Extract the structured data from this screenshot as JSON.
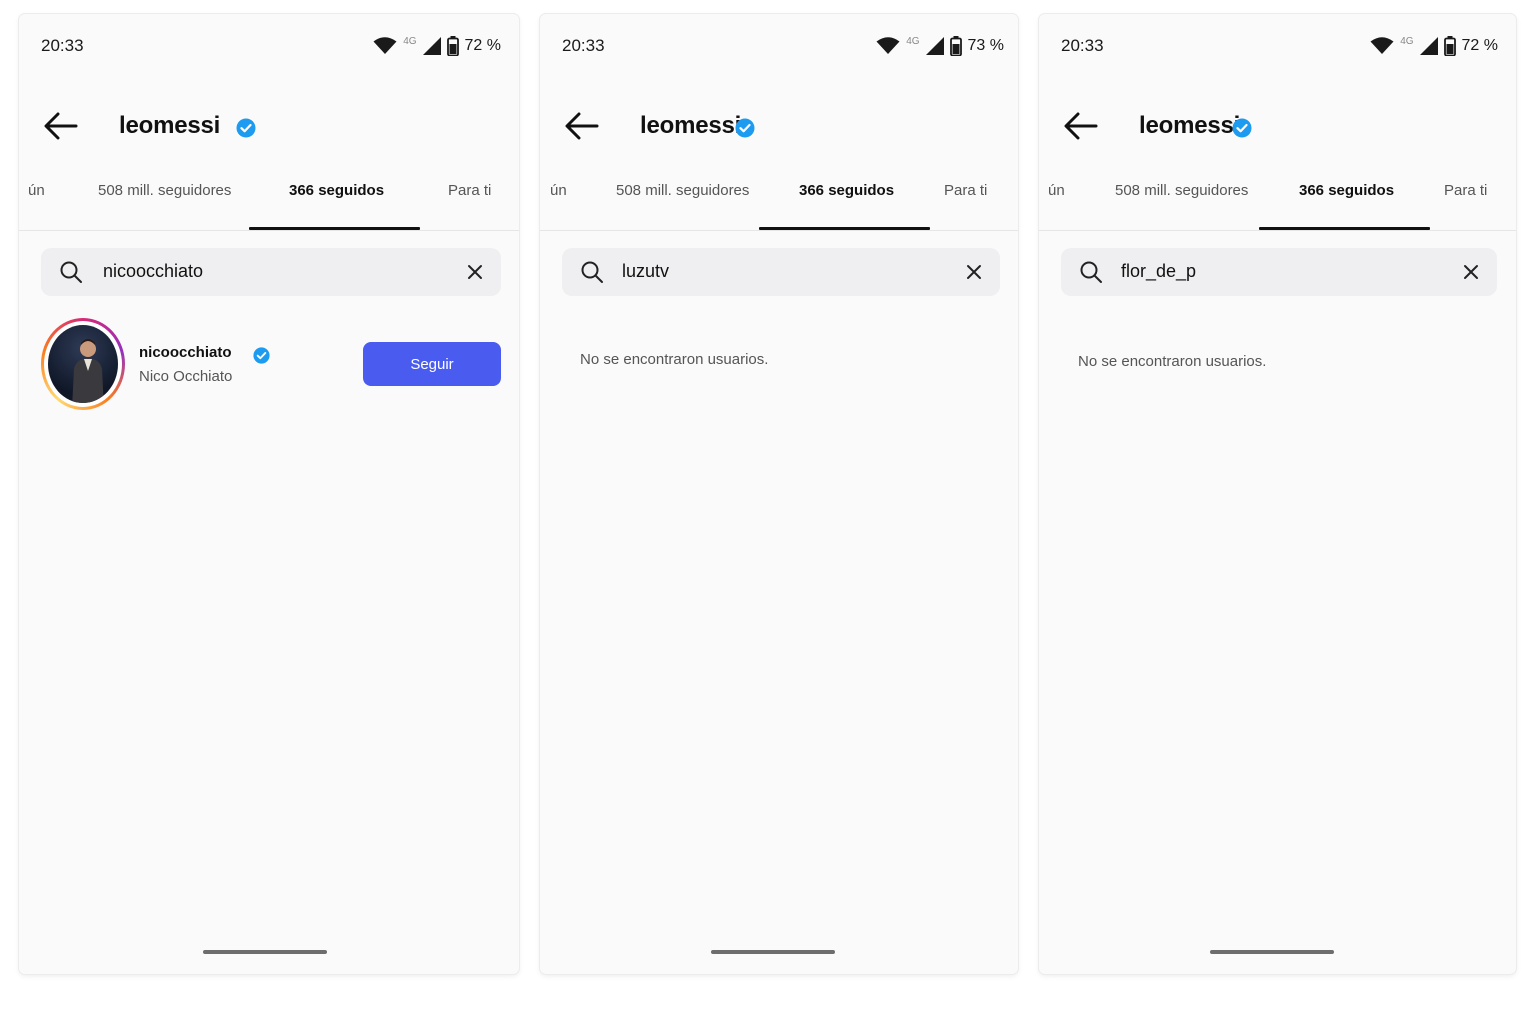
{
  "colors": {
    "accent": "#4a5cf0",
    "verified": "#1d9bf0",
    "story_ring": "#d62976"
  },
  "screens": [
    {
      "status": {
        "time": "20:33",
        "network": "4G",
        "battery": "72 %"
      },
      "header": {
        "username": "leomessi",
        "verified_icon": "verified-badge-icon"
      },
      "tabs": [
        "ún",
        "508 mill. seguidores",
        "366 seguidos",
        "Para ti"
      ],
      "active_tab": "366 seguidos",
      "search": {
        "value": "nicoocchiato"
      },
      "result": {
        "username": "nicoocchiato",
        "full_name": "Nico Occhiato",
        "button": "Seguir"
      }
    },
    {
      "status": {
        "time": "20:33",
        "network": "4G",
        "battery": "73 %"
      },
      "header": {
        "username": "leomessi",
        "verified_icon": "verified-badge-icon"
      },
      "tabs": [
        "ún",
        "508 mill. seguidores",
        "366 seguidos",
        "Para ti"
      ],
      "active_tab": "366 seguidos",
      "search": {
        "value": "luzutv"
      },
      "empty_message": "No se encontraron usuarios."
    },
    {
      "status": {
        "time": "20:33",
        "network": "4G",
        "battery": "72 %"
      },
      "header": {
        "username": "leomessi",
        "verified_icon": "verified-badge-icon"
      },
      "tabs": [
        "ún",
        "508 mill. seguidores",
        "366 seguidos",
        "Para ti"
      ],
      "active_tab": "366 seguidos",
      "search": {
        "value": "flor_de_p"
      },
      "empty_message": "No se encontraron usuarios."
    }
  ]
}
